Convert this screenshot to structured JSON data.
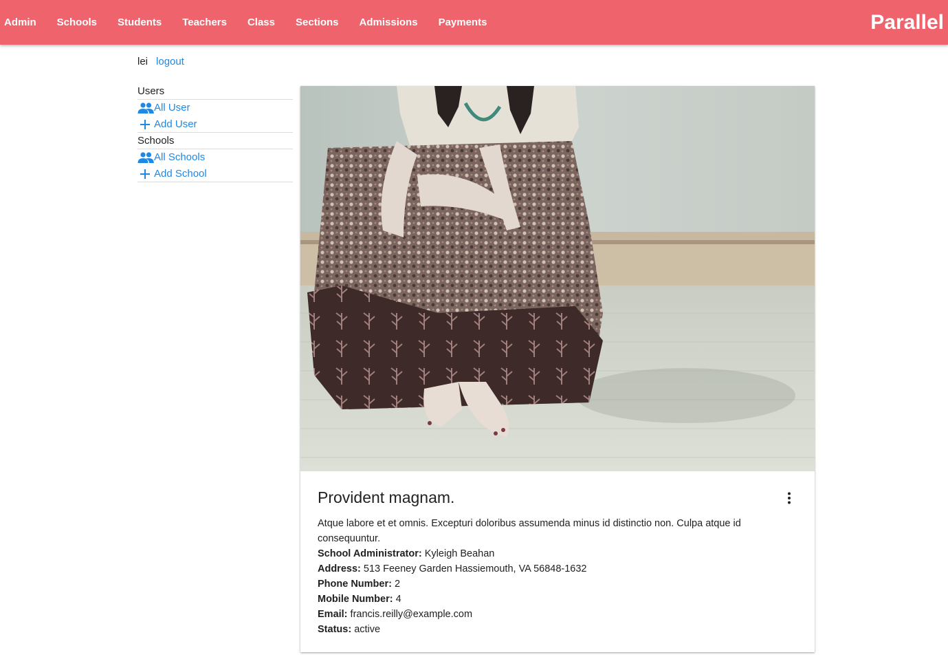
{
  "nav": {
    "items": [
      "Admin",
      "Schools",
      "Students",
      "Teachers",
      "Class",
      "Sections",
      "Admissions",
      "Payments"
    ],
    "brand": "Parallel",
    "color": "#ef646c"
  },
  "user": {
    "name": "lei",
    "logout_label": "logout"
  },
  "sidebar": {
    "users_header": "Users",
    "all_user": "All User",
    "add_user": "Add User",
    "schools_header": "Schools",
    "all_schools": "All Schools",
    "add_school": "Add School",
    "link_color": "#1e88e5",
    "icons": [
      "people-icon",
      "plus-icon"
    ]
  },
  "card": {
    "title": "Provident magnam.",
    "description": "Atque labore et et omnis. Excepturi doloribus assumenda minus id distinctio non. Culpa atque id consequuntur.",
    "fields": [
      {
        "label": "School Administrator:",
        "value": "Kyleigh Beahan"
      },
      {
        "label": "Address:",
        "value": "513 Feeney Garden Hassiemouth, VA 56848-1632"
      },
      {
        "label": "Phone Number:",
        "value": "2"
      },
      {
        "label": "Mobile Number:",
        "value": "4"
      },
      {
        "label": "Email:",
        "value": "francis.reilly@example.com"
      },
      {
        "label": "Status:",
        "value": "active"
      }
    ],
    "menu_icon": "more-vert-icon"
  }
}
